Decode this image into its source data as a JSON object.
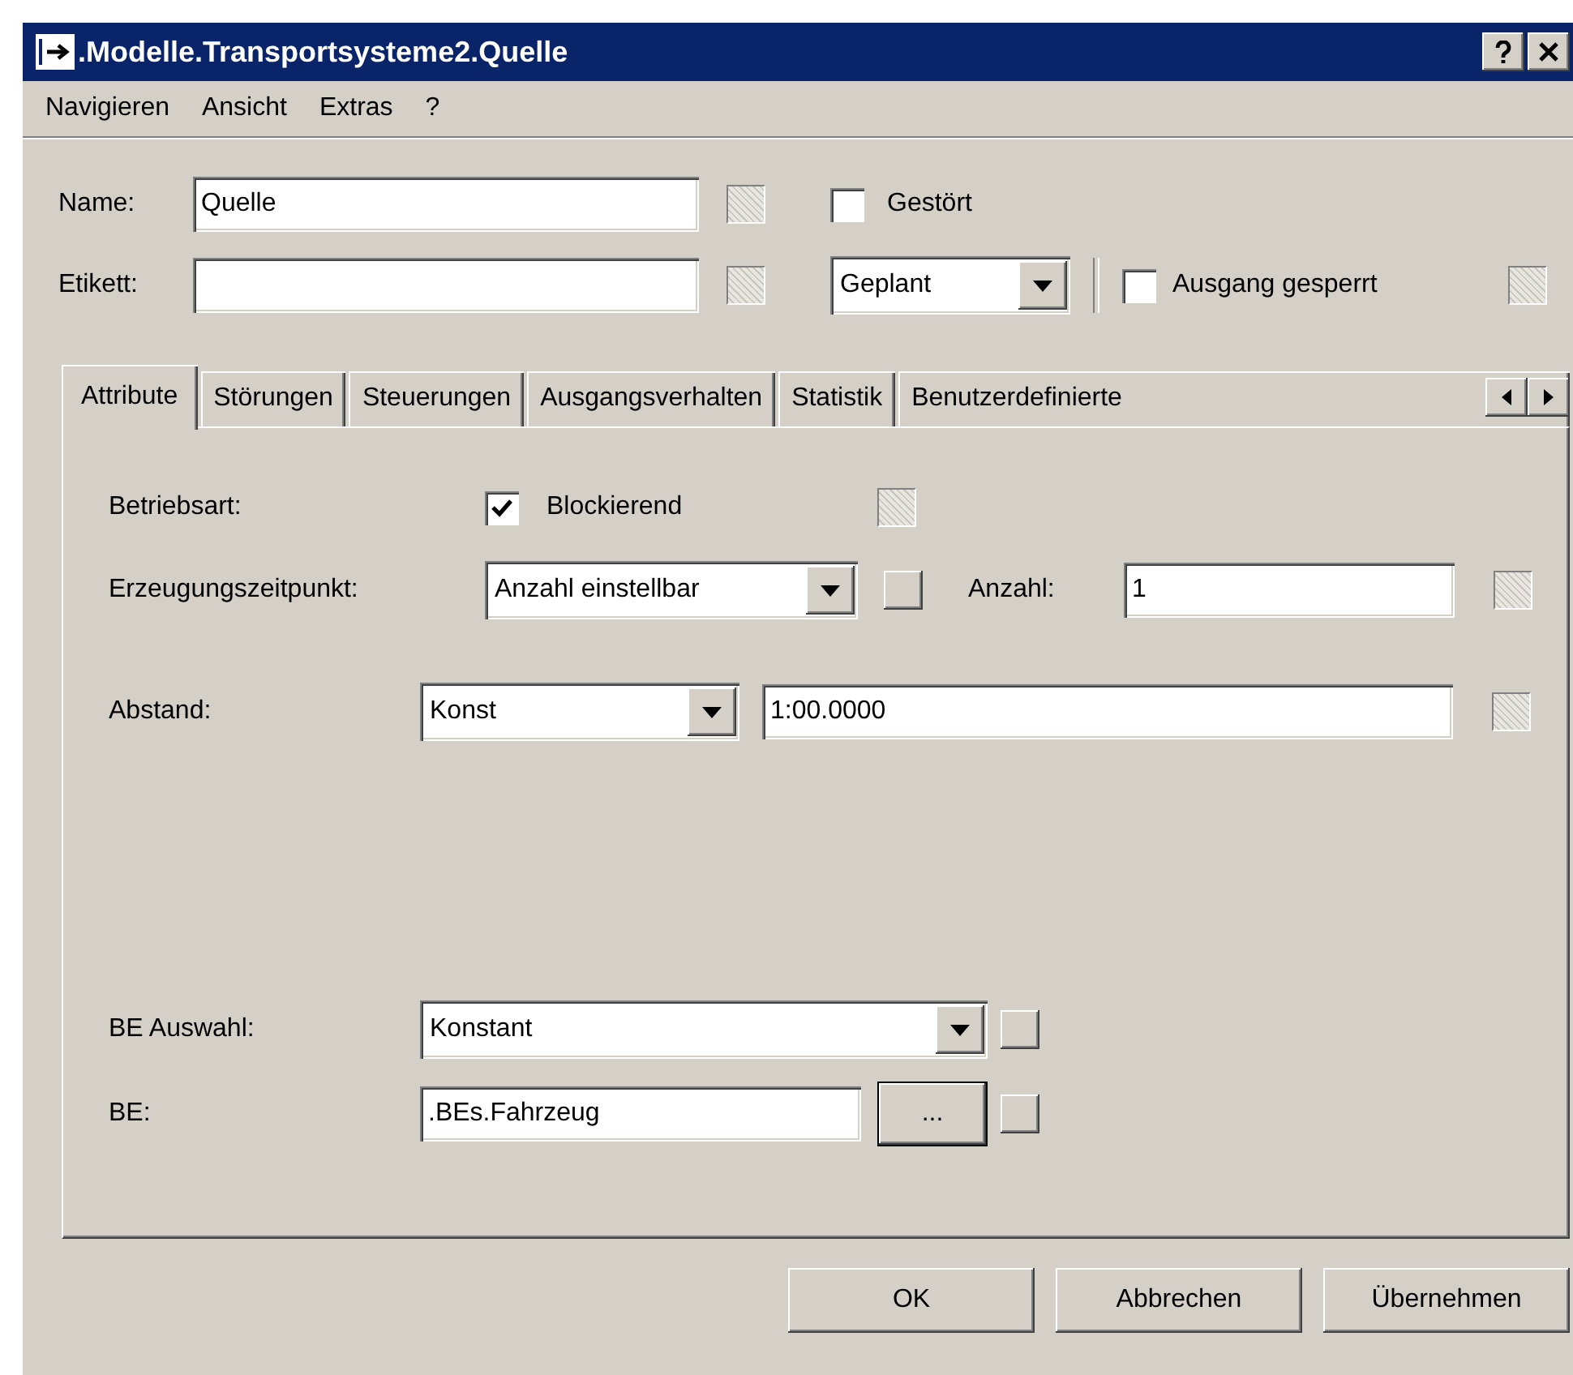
{
  "window": {
    "title": ".Modelle.Transportsysteme2.Quelle"
  },
  "menu": [
    {
      "label": "Navigieren"
    },
    {
      "label": "Ansicht"
    },
    {
      "label": "Extras"
    },
    {
      "label": "?"
    }
  ],
  "name": {
    "label": "Name:",
    "value": "Quelle",
    "flag": {
      "kind": "checkbox",
      "checked": false
    }
  },
  "label_field": {
    "label": "Etikett:",
    "flag": {
      "kind": "checkbox",
      "checked": false
    }
  },
  "disturbed": {
    "label": "Gestört",
    "checked": false
  },
  "plan": {
    "value": "Geplant"
  },
  "exit_locked": {
    "label": "Ausgang gesperrt",
    "checked": false,
    "flag": {
      "kind": "checkbox",
      "checked": false
    }
  },
  "tabs": [
    {
      "label": "Attribute",
      "selected": true
    },
    {
      "label": "Störungen",
      "selected": false
    },
    {
      "label": "Steuerungen",
      "selected": false
    },
    {
      "label": "Ausgangsverhalten",
      "selected": false
    },
    {
      "label": "Statistik",
      "selected": false
    },
    {
      "label": "Benutzerdefinierte",
      "selected": false
    }
  ],
  "attributes": {
    "mode": {
      "label": "Betriebsart:",
      "option": "Blockierend",
      "checked": true,
      "flag": {
        "kind": "checkbox",
        "checked": false
      }
    },
    "creation": {
      "label": "Erzeugungszeitpunkt:",
      "value": "Anzahl einstellbar",
      "flag": {
        "kind": "button"
      },
      "count_label": "Anzahl:",
      "count": "1",
      "count_flag": {
        "kind": "checkbox",
        "checked": false
      }
    },
    "interval": {
      "label": "Abstand:",
      "distribution": "Konst",
      "value": "1:00.0000",
      "flag": {
        "kind": "checkbox",
        "checked": false
      }
    },
    "mu_selection": {
      "label": "BE Auswahl:",
      "value": "Konstant",
      "flag": {
        "kind": "button"
      }
    },
    "mu": {
      "label": "BE:",
      "value": ".BEs.Fahrzeug",
      "browse": "...",
      "flag": {
        "kind": "button"
      }
    }
  },
  "buttons": [
    {
      "label": "OK"
    },
    {
      "label": "Abbrechen"
    },
    {
      "label": "Übernehmen"
    }
  ]
}
